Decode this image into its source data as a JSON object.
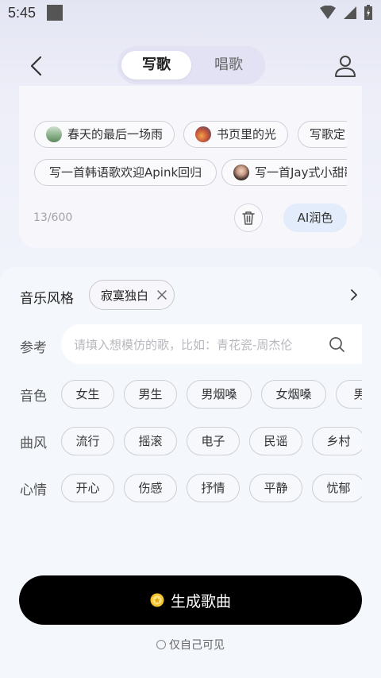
{
  "status_bar": {
    "time": "5:45",
    "icons": [
      "wifi-icon",
      "signal-icon",
      "battery-icon"
    ]
  },
  "header": {
    "back_icon": "chevron-left-icon",
    "tabs": [
      {
        "label": "写歌",
        "active": true
      },
      {
        "label": "唱歌",
        "active": false
      }
    ],
    "profile_icon": "user-icon"
  },
  "lyrics_card": {
    "suggestions_row1": [
      {
        "label": "春天的最后一场雨",
        "thumb": "landscape"
      },
      {
        "label": "书页里的光",
        "thumb": "sunset"
      },
      {
        "label": "写歌定",
        "thumb": ""
      }
    ],
    "suggestions_row2": [
      {
        "label": "写一首韩语歌欢迎Apink回归",
        "thumb": ""
      },
      {
        "label": "写一首Jay式小甜歌",
        "thumb": "portrait"
      }
    ],
    "char_count": "13/600",
    "clear_icon": "trash-icon",
    "polish_label": "AI润色"
  },
  "options": {
    "style_label": "音乐风格",
    "selected_style": "寂寞独白",
    "reference_label": "参考",
    "reference_placeholder": "请填入想模仿的歌，比如：青花瓷-周杰伦",
    "voice_label": "音色",
    "voice_options": [
      "女生",
      "男生",
      "男烟嗓",
      "女烟嗓",
      "男"
    ],
    "genre_label": "曲风",
    "genre_options": [
      "流行",
      "摇滚",
      "电子",
      "民谣",
      "乡村"
    ],
    "mood_label": "心情",
    "mood_options": [
      "开心",
      "伤感",
      "抒情",
      "平静",
      "忧郁"
    ]
  },
  "generate": {
    "label": "生成歌曲",
    "icon": "coin-icon"
  },
  "privacy": {
    "label": "仅自己可见",
    "checked": false
  },
  "colors": {
    "accent_black": "#000000",
    "polish_bg": "#e2ecfa",
    "tab_bg": "#e2e2f4"
  }
}
